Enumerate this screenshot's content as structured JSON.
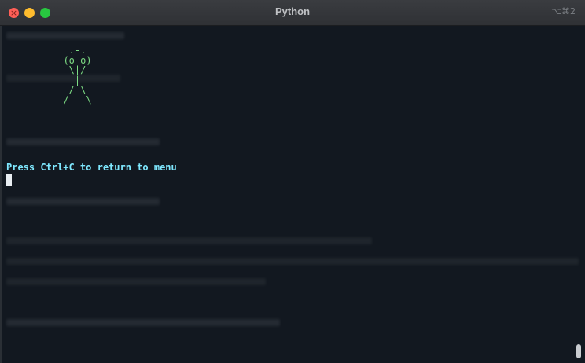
{
  "window": {
    "title": "Python",
    "shortcut": "⌥⌘2",
    "close_glyph": "×"
  },
  "terminal": {
    "ascii_art": "   .-.\n  (o o)\n   \\|/\n    |\n   / \\\n  /   \\",
    "message": "Press Ctrl+C to return to menu"
  },
  "colors": {
    "ascii_green": "#7ddc84",
    "message_cyan": "#7fe8ff",
    "background": "#121820",
    "traffic_close": "#ff5f57",
    "traffic_minimize": "#febc2e",
    "traffic_maximize": "#28c840"
  }
}
